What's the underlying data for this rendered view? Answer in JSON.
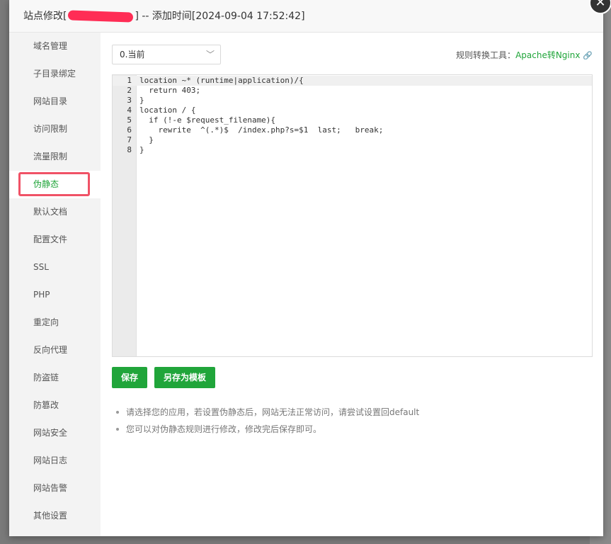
{
  "dialog": {
    "title_prefix": "站点修改[",
    "title_suffix": "] -- 添加时间[2024-09-04 17:52:42]",
    "close_glyph": "✕"
  },
  "sidebar": {
    "items": [
      {
        "label": "域名管理"
      },
      {
        "label": "子目录绑定"
      },
      {
        "label": "网站目录"
      },
      {
        "label": "访问限制"
      },
      {
        "label": "流量限制"
      },
      {
        "label": "伪静态",
        "active": true
      },
      {
        "label": "默认文档"
      },
      {
        "label": "配置文件"
      },
      {
        "label": "SSL"
      },
      {
        "label": "PHP"
      },
      {
        "label": "重定向"
      },
      {
        "label": "反向代理"
      },
      {
        "label": "防盗链"
      },
      {
        "label": "防篡改"
      },
      {
        "label": "网站安全"
      },
      {
        "label": "网站日志"
      },
      {
        "label": "网站告警"
      },
      {
        "label": "其他设置"
      }
    ]
  },
  "rewrite": {
    "template_select": "0.当前",
    "tool_label": "规则转换工具：",
    "tool_link": "Apache转Nginx",
    "code_lines": [
      {
        "no": "1",
        "text": "location ~* (runtime|application)/{"
      },
      {
        "no": "2",
        "text": "  return 403;"
      },
      {
        "no": "3",
        "text": "}"
      },
      {
        "no": "4",
        "text": "location / {"
      },
      {
        "no": "5",
        "text": "  if (!-e $request_filename){"
      },
      {
        "no": "6",
        "text": "    rewrite  ^(.*)$  /index.php?s=$1  last;   break;"
      },
      {
        "no": "7",
        "text": "  }"
      },
      {
        "no": "8",
        "text": "}"
      }
    ],
    "save_label": "保存",
    "save_template_label": "另存为模板",
    "tips": [
      "请选择您的应用，若设置伪静态后，网站无法正常访问，请尝试设置回default",
      "您可以对伪静态规则进行修改，修改完后保存即可。"
    ]
  },
  "colors": {
    "accent": "#20a53a",
    "highlight_box": "#f05266"
  }
}
